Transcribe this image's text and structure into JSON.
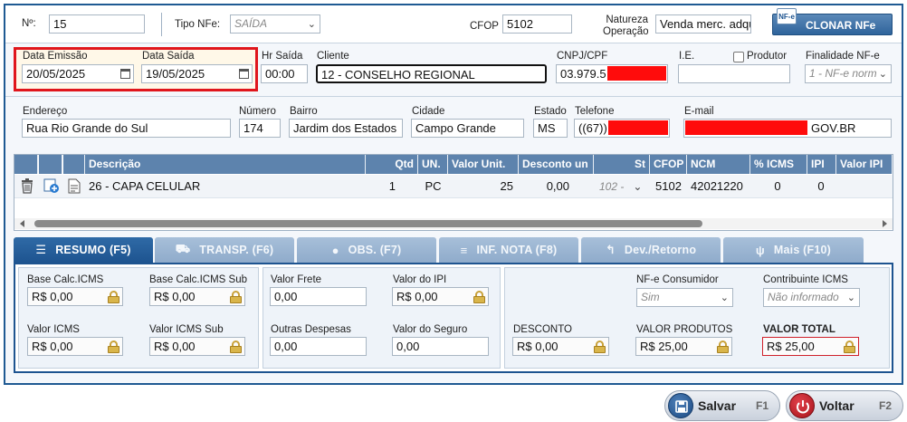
{
  "header": {
    "numero_label": "Nº:",
    "numero_value": "15",
    "tipo_label": "Tipo NFe:",
    "tipo_value": "SAÍDA",
    "cfop_label": "CFOP",
    "cfop_value": "5102",
    "natureza_label_1": "Natureza",
    "natureza_label_2": "Operação",
    "natureza_value": "Venda merc. adqu",
    "clonar_label": "CLONAR NFe",
    "nfe_badge": "NF-e"
  },
  "datas": {
    "emissao_label": "Data Emissão",
    "emissao_value": "20/05/2025",
    "saida_label": "Data Saída",
    "saida_value": "19/05/2025",
    "hr_label": "Hr Saída",
    "hr_value": "00:00"
  },
  "cliente": {
    "label": "Cliente",
    "value": "12 - CONSELHO REGIONAL",
    "cnpj_label": "CNPJ/CPF",
    "cnpj_value": "03.979.5",
    "ie_label": "I.E.",
    "ie_value": "",
    "produtor_label": "Produtor",
    "finalidade_label": "Finalidade NF-e",
    "finalidade_value": "1 - NF-e norm"
  },
  "endereco": {
    "endereco_label": "Endereço",
    "endereco_value": "Rua Rio Grande do Sul",
    "numero_label": "Número",
    "numero_value": "174",
    "bairro_label": "Bairro",
    "bairro_value": "Jardim dos Estados",
    "cidade_label": "Cidade",
    "cidade_value": "Campo Grande",
    "estado_label": "Estado",
    "estado_value": "MS",
    "telefone_label": "Telefone",
    "telefone_value": "((67))",
    "email_label": "E-mail",
    "email_value": "GOV.BR"
  },
  "items": {
    "columns": [
      "Descrição",
      "Qtd",
      "UN.",
      "Valor Unit.",
      "Desconto un",
      "St",
      "CFOP",
      "NCM",
      "% ICMS",
      "IPI",
      "Valor IPI"
    ],
    "row": {
      "descricao": "26 - CAPA CELULAR",
      "qtd": "1",
      "un": "PC",
      "valor_unit": "25",
      "desconto": "0,00",
      "st": "102 -",
      "cfop": "5102",
      "ncm": "42021220",
      "icms": "0",
      "ipi": "0"
    }
  },
  "tabs": [
    {
      "label": "RESUMO (F5)",
      "icon": "list-icon"
    },
    {
      "label": "TRANSP. (F6)",
      "icon": "truck-icon"
    },
    {
      "label": "OBS. (F7)",
      "icon": "chat-icon"
    },
    {
      "label": "INF. NOTA (F8)",
      "icon": "database-icon"
    },
    {
      "label": "Dev./Retorno",
      "icon": "return-icon"
    },
    {
      "label": "Mais (F10)",
      "icon": "fork-icon"
    }
  ],
  "resumo": {
    "bc_icms_label": "Base Calc.ICMS",
    "bc_icms_value": "R$ 0,00",
    "bc_icms_sub_label": "Base Calc.ICMS Sub",
    "bc_icms_sub_value": "R$ 0,00",
    "v_icms_label": "Valor ICMS",
    "v_icms_value": "R$ 0,00",
    "v_icms_sub_label": "Valor ICMS Sub",
    "v_icms_sub_value": "R$ 0,00",
    "frete_label": "Valor Frete",
    "frete_value": "0,00",
    "ipi_label": "Valor do IPI",
    "ipi_value": "R$ 0,00",
    "outras_label": "Outras Despesas",
    "outras_value": "0,00",
    "seguro_label": "Valor do Seguro",
    "seguro_value": "0,00",
    "consumidor_label": "NF-e Consumidor",
    "consumidor_value": "Sim",
    "contribuinte_label": "Contribuinte ICMS",
    "contribuinte_value": "Não informado",
    "desconto_label": "DESCONTO",
    "desconto_value": "R$ 0,00",
    "produtos_label": "VALOR PRODUTOS",
    "produtos_value": "R$ 25,00",
    "total_label": "VALOR TOTAL",
    "total_value": "R$ 25,00"
  },
  "footer": {
    "salvar_label": "Salvar",
    "salvar_key": "F1",
    "voltar_label": "Voltar",
    "voltar_key": "F2"
  },
  "colors": {
    "accent": "#1e5490",
    "highlight": "#e0161c",
    "redaction": "#ff0c0c"
  }
}
